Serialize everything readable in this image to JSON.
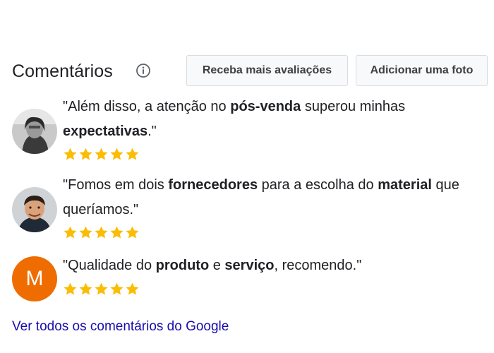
{
  "header": {
    "title": "Comentários",
    "info_icon": "info-circle-icon",
    "buttons": {
      "get_reviews": "Receba mais avaliações",
      "add_photo": "Adicionar uma foto"
    }
  },
  "reviews": [
    {
      "avatar": "photo-avatar-woman-bw",
      "text": {
        "a": "\"Além disso, a atenção no ",
        "b1": "pós-venda",
        "c": " superou minhas ",
        "b2": "expectativas",
        "d": ".\""
      },
      "rating": 5
    },
    {
      "avatar": "photo-avatar-man",
      "text": {
        "a": "\"Fomos em dois ",
        "b1": "fornecedores",
        "c": " para a escolha do ",
        "b2": "material",
        "d": " que queríamos.\""
      },
      "rating": 5
    },
    {
      "avatar_letter": "M",
      "avatar_color": "#ef6c00",
      "text": {
        "a": "\"Qualidade do ",
        "b1": "produto",
        "c": " e ",
        "b2": "serviço",
        "d": ", recomendo.\""
      },
      "rating": 5
    }
  ],
  "star_color": "#fbbc04",
  "footer": {
    "link": "Ver todos os comentários do Google"
  }
}
